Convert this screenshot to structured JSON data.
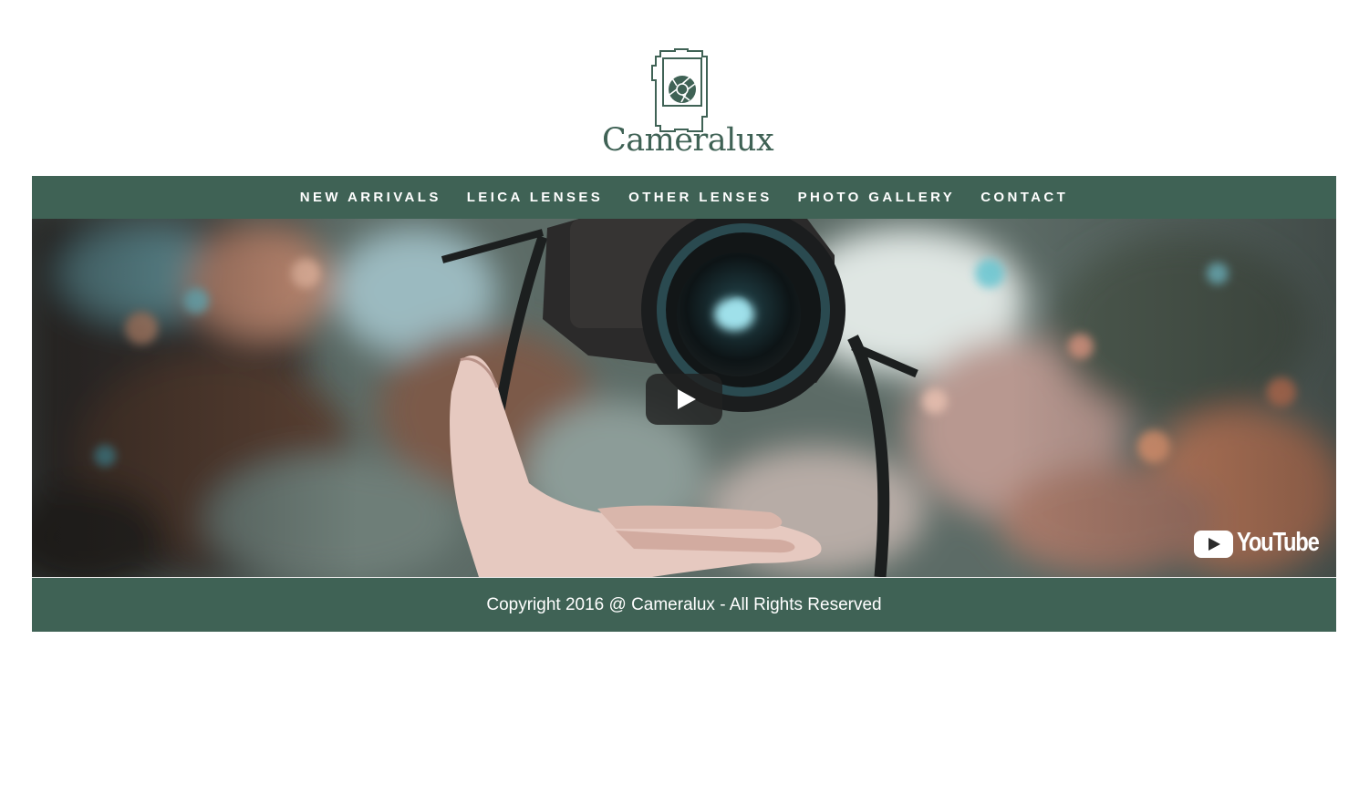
{
  "brand": {
    "name": "Cameralux",
    "color": "#3f6255"
  },
  "nav": {
    "items": [
      {
        "label": "NEW ARRIVALS"
      },
      {
        "label": "LEICA LENSES"
      },
      {
        "label": "OTHER LENSES"
      },
      {
        "label": "PHOTO GALLERY"
      },
      {
        "label": "CONTACT"
      }
    ]
  },
  "video": {
    "provider_logo": "YouTube",
    "play_icon": "play-icon",
    "background": "bokeh-forest-hand-catching-camera"
  },
  "footer": {
    "copyright": "Copyright 2016 @ Cameralux - All Rights Reserved"
  }
}
